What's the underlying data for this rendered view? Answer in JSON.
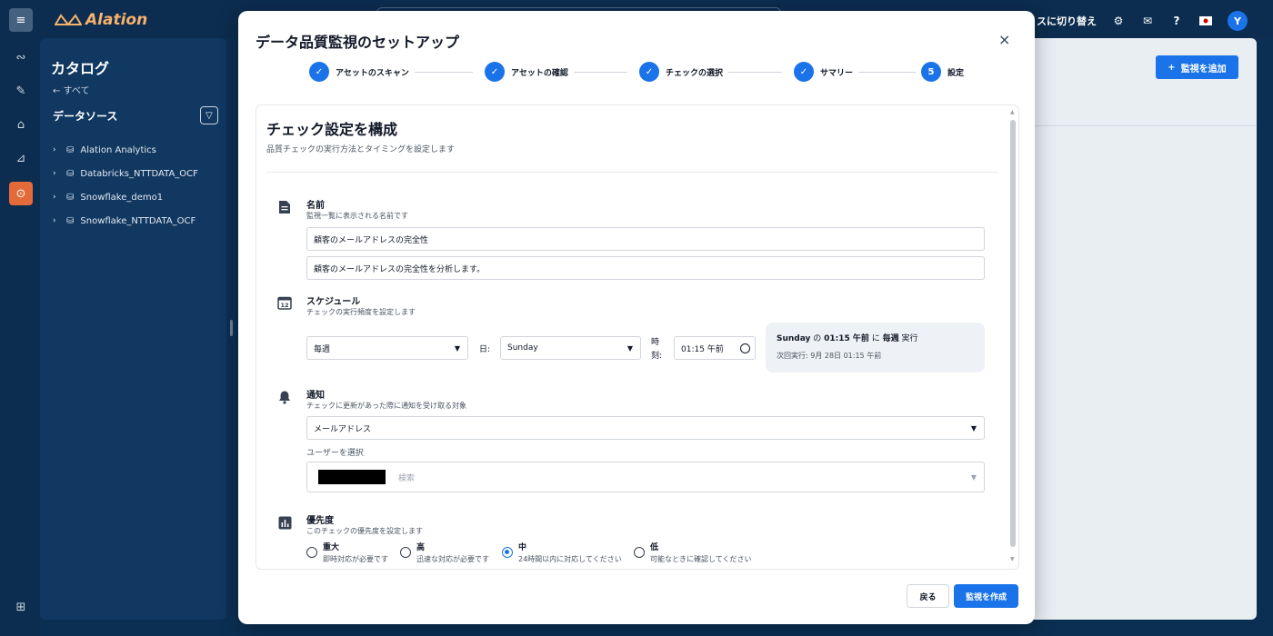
{
  "app": {
    "logo": "Alation",
    "top_right_label": "スに切り替え",
    "avatar_initial": "Y"
  },
  "sidebar": {
    "title": "カタログ",
    "back_label": "← すべて",
    "section_title": "データソース",
    "items": [
      {
        "label": "Alation Analytics"
      },
      {
        "label": "Databricks_NTTDATA_OCF"
      },
      {
        "label": "Snowflake_demo1"
      },
      {
        "label": "Snowflake_NTTDATA_OCF"
      }
    ]
  },
  "background": {
    "add_monitor_label": "監視を追加"
  },
  "modal": {
    "title": "データ品質監視のセットアップ",
    "close": "×",
    "steps": [
      {
        "label": "アセットのスキャン",
        "marker": "✓"
      },
      {
        "label": "アセットの確認",
        "marker": "✓"
      },
      {
        "label": "チェックの選択",
        "marker": "✓"
      },
      {
        "label": "サマリー",
        "marker": "✓"
      },
      {
        "label": "設定",
        "marker": "5"
      }
    ],
    "section_title": "チェック設定を構成",
    "section_desc": "品質チェックの実行方法とタイミングを設定します",
    "name_block": {
      "label": "名前",
      "hint": "監視一覧に表示される名前です",
      "name_value": "顧客のメールアドレスの完全性",
      "description_value": "顧客のメールアドレスの完全性を分析します。"
    },
    "schedule_block": {
      "label": "スケジュール",
      "hint": "チェックの実行頻度を設定します",
      "frequency": "毎週",
      "day_label": "日:",
      "day_value": "Sunday",
      "time_label_1": "時",
      "time_label_2": "刻:",
      "time_value": "01:15 午前",
      "summary": {
        "day": "Sunday",
        "of": " の ",
        "time": "01:15 午前",
        "at": " に ",
        "freq": "毎週",
        "run": " 実行",
        "next_run": "次回実行: 9月 28日 01:15 午前"
      }
    },
    "notify_block": {
      "label": "通知",
      "hint": "チェックに更新があった際に通知を受け取る対象",
      "channel": "メールアドレス",
      "user_select_label": "ユーザーを選択",
      "search_placeholder": "検索"
    },
    "priority_block": {
      "label": "優先度",
      "hint": "このチェックの優先度を設定します",
      "options": [
        {
          "title": "重大",
          "sub": "即時対応が必要です",
          "selected": false
        },
        {
          "title": "高",
          "sub": "迅速な対応が必要です",
          "selected": false
        },
        {
          "title": "中",
          "sub": "24時間以内に対応してください",
          "selected": true
        },
        {
          "title": "低",
          "sub": "可能なときに確認してください",
          "selected": false
        }
      ]
    },
    "back_button": "戻る",
    "create_button": "監視を作成"
  }
}
